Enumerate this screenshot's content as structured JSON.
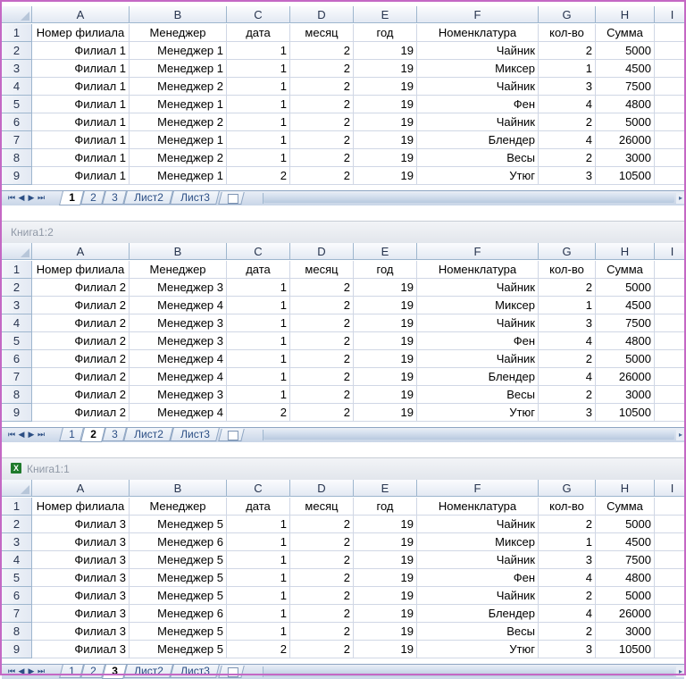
{
  "columns": [
    "A",
    "B",
    "C",
    "D",
    "E",
    "F",
    "G",
    "H",
    "I"
  ],
  "header_row": [
    "Номер филиала",
    "Менеджер",
    "дата",
    "месяц",
    "год",
    "Номенклатура",
    "кол-во",
    "Сумма",
    ""
  ],
  "row_numbers": [
    "1",
    "2",
    "3",
    "4",
    "5",
    "6",
    "7",
    "8",
    "9"
  ],
  "sheet_tabs": [
    "1",
    "2",
    "3",
    "Лист2",
    "Лист3"
  ],
  "nav_buttons": [
    "⏮",
    "◀",
    "▶",
    "⏭"
  ],
  "windows": [
    {
      "title": "",
      "active_tab": 0,
      "rows": [
        [
          "Филиал 1",
          "Менеджер 1",
          "1",
          "2",
          "19",
          "Чайник",
          "2",
          "5000"
        ],
        [
          "Филиал 1",
          "Менеджер 1",
          "1",
          "2",
          "19",
          "Миксер",
          "1",
          "4500"
        ],
        [
          "Филиал 1",
          "Менеджер 2",
          "1",
          "2",
          "19",
          "Чайник",
          "3",
          "7500"
        ],
        [
          "Филиал 1",
          "Менеджер 1",
          "1",
          "2",
          "19",
          "Фен",
          "4",
          "4800"
        ],
        [
          "Филиал 1",
          "Менеджер 2",
          "1",
          "2",
          "19",
          "Чайник",
          "2",
          "5000"
        ],
        [
          "Филиал 1",
          "Менеджер 1",
          "1",
          "2",
          "19",
          "Блендер",
          "4",
          "26000"
        ],
        [
          "Филиал 1",
          "Менеджер 2",
          "1",
          "2",
          "19",
          "Весы",
          "2",
          "3000"
        ],
        [
          "Филиал 1",
          "Менеджер 1",
          "2",
          "2",
          "19",
          "Утюг",
          "3",
          "10500"
        ]
      ]
    },
    {
      "title": "Книга1:2",
      "active_tab": 1,
      "rows": [
        [
          "Филиал 2",
          "Менеджер 3",
          "1",
          "2",
          "19",
          "Чайник",
          "2",
          "5000"
        ],
        [
          "Филиал 2",
          "Менеджер 4",
          "1",
          "2",
          "19",
          "Миксер",
          "1",
          "4500"
        ],
        [
          "Филиал 2",
          "Менеджер 3",
          "1",
          "2",
          "19",
          "Чайник",
          "3",
          "7500"
        ],
        [
          "Филиал 2",
          "Менеджер 3",
          "1",
          "2",
          "19",
          "Фен",
          "4",
          "4800"
        ],
        [
          "Филиал 2",
          "Менеджер 4",
          "1",
          "2",
          "19",
          "Чайник",
          "2",
          "5000"
        ],
        [
          "Филиал 2",
          "Менеджер 4",
          "1",
          "2",
          "19",
          "Блендер",
          "4",
          "26000"
        ],
        [
          "Филиал 2",
          "Менеджер 3",
          "1",
          "2",
          "19",
          "Весы",
          "2",
          "3000"
        ],
        [
          "Филиал 2",
          "Менеджер 4",
          "2",
          "2",
          "19",
          "Утюг",
          "3",
          "10500"
        ]
      ]
    },
    {
      "title": "Книга1:1",
      "active_tab": 2,
      "rows": [
        [
          "Филиал 3",
          "Менеджер 5",
          "1",
          "2",
          "19",
          "Чайник",
          "2",
          "5000"
        ],
        [
          "Филиал 3",
          "Менеджер 6",
          "1",
          "2",
          "19",
          "Миксер",
          "1",
          "4500"
        ],
        [
          "Филиал 3",
          "Менеджер 5",
          "1",
          "2",
          "19",
          "Чайник",
          "3",
          "7500"
        ],
        [
          "Филиал 3",
          "Менеджер 5",
          "1",
          "2",
          "19",
          "Фен",
          "4",
          "4800"
        ],
        [
          "Филиал 3",
          "Менеджер 5",
          "1",
          "2",
          "19",
          "Чайник",
          "2",
          "5000"
        ],
        [
          "Филиал 3",
          "Менеджер 6",
          "1",
          "2",
          "19",
          "Блендер",
          "4",
          "26000"
        ],
        [
          "Филиал 3",
          "Менеджер 5",
          "1",
          "2",
          "19",
          "Весы",
          "2",
          "3000"
        ],
        [
          "Филиал 3",
          "Менеджер 5",
          "2",
          "2",
          "19",
          "Утюг",
          "3",
          "10500"
        ]
      ]
    }
  ]
}
